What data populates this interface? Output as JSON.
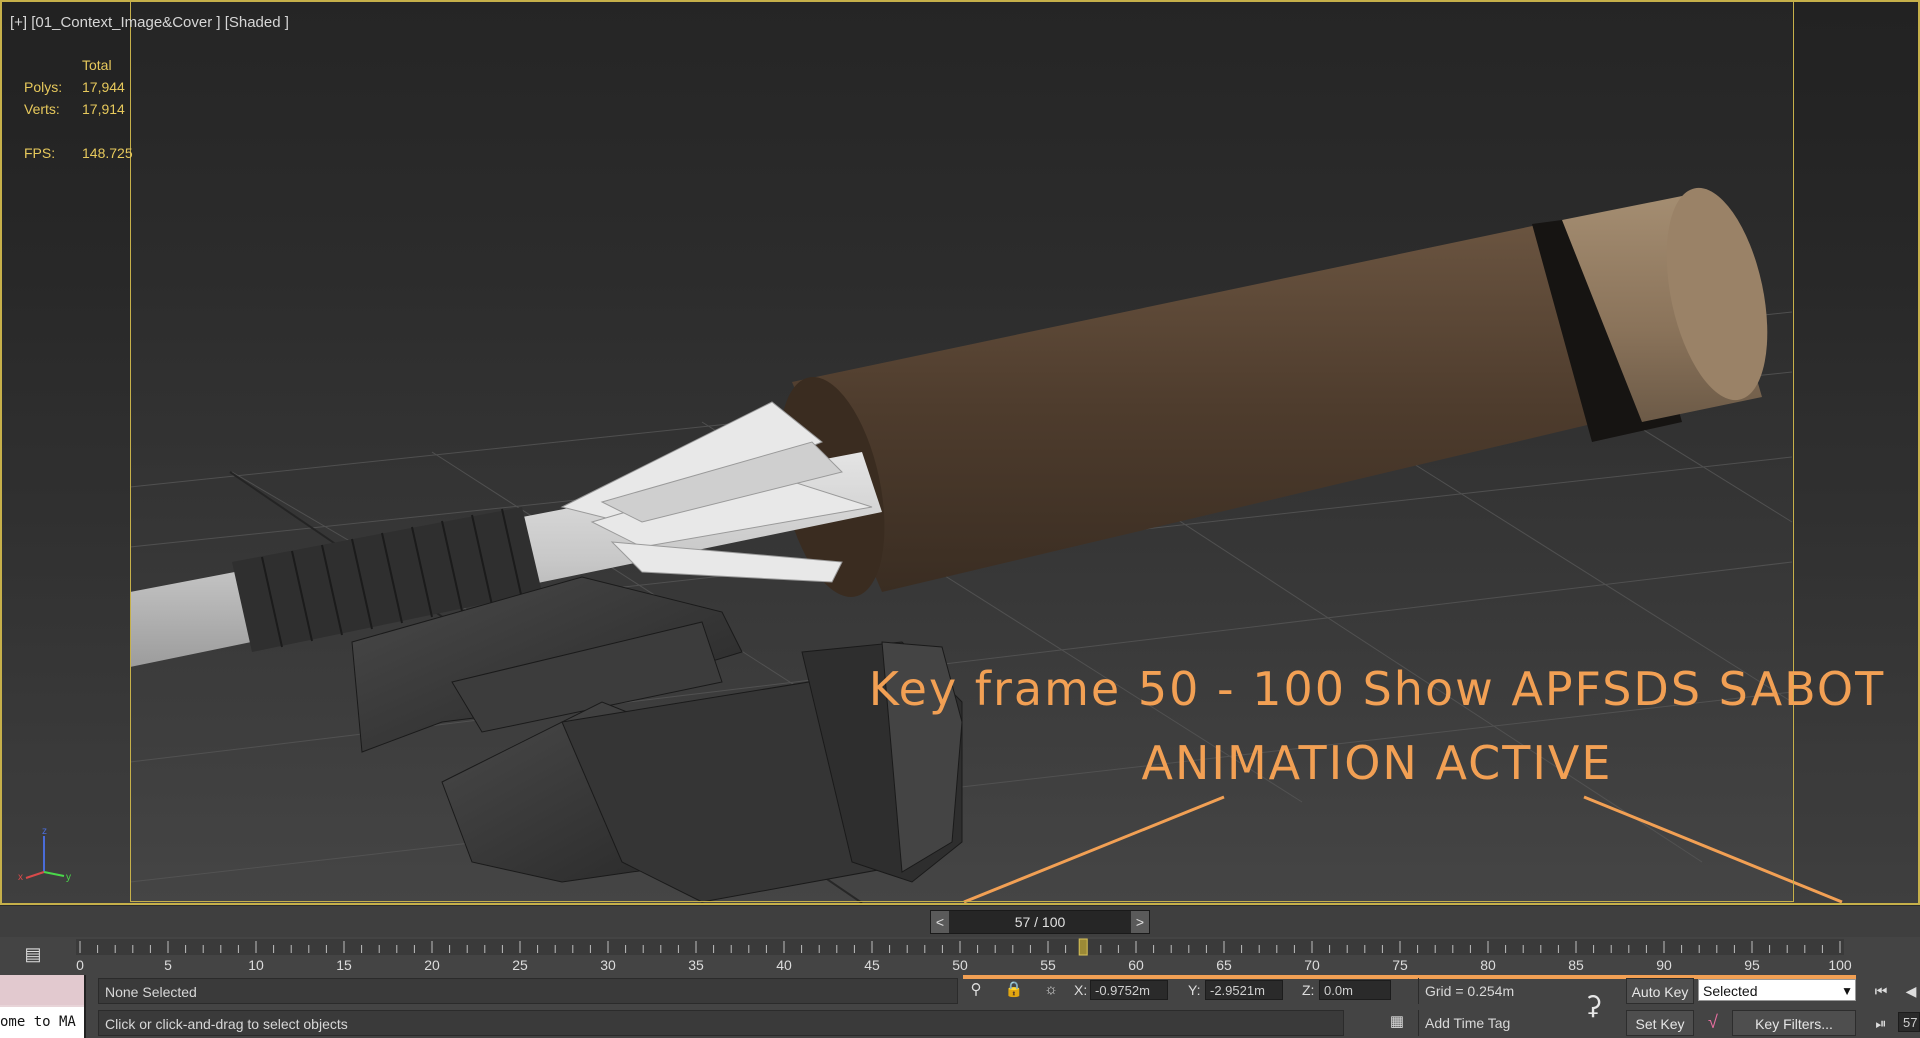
{
  "viewport": {
    "label": "[+] [01_Context_Image&Cover ] [Shaded ]",
    "stats": {
      "header": "Total",
      "polys_label": "Polys:",
      "polys_value": "17,944",
      "verts_label": "Verts:",
      "verts_value": "17,914",
      "fps_label": "FPS:",
      "fps_value": "148.725"
    },
    "overlay_line1": "Key frame 50 - 100 Show APFSDS SABOT",
    "overlay_line2": "ANIMATION ACTIVE",
    "overlay_color": "#f2a054",
    "axis": {
      "x": "x",
      "y": "y",
      "z": "z"
    }
  },
  "time_slider": {
    "prev": "<",
    "next": ">",
    "frame_label": "57 / 100",
    "current_frame": 57,
    "total_frames": 100
  },
  "trackbar": {
    "tick_labels": [
      "0",
      "5",
      "10",
      "15",
      "20",
      "25",
      "30",
      "35",
      "40",
      "45",
      "50",
      "55",
      "60",
      "65",
      "70",
      "75",
      "80",
      "85",
      "90",
      "95",
      "100"
    ],
    "range": [
      0,
      100
    ]
  },
  "statusbar": {
    "script_text": "ome to MA",
    "selection": "None Selected",
    "prompt": "Click or click-and-drag to select objects",
    "x_label": "X:",
    "x_value": "-0.9752m",
    "y_label": "Y:",
    "y_value": "-2.9521m",
    "z_label": "Z:",
    "z_value": "0.0m",
    "grid": "Grid = 0.254m",
    "add_time_tag": "Add Time Tag",
    "auto_key": "Auto Key",
    "set_key": "Set Key",
    "selected_option": "Selected",
    "key_filters": "Key Filters...",
    "frame_partial": "57"
  }
}
